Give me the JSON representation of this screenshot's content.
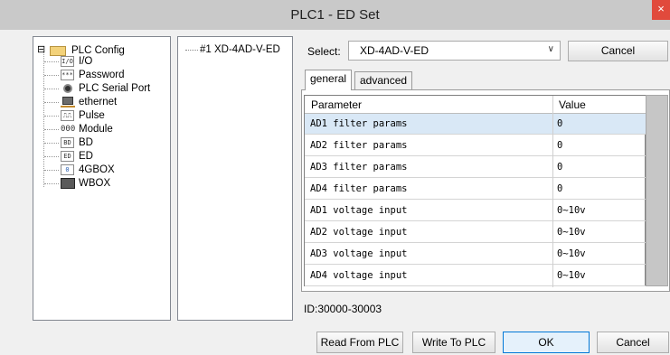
{
  "window": {
    "title": "PLC1 - ED Set",
    "close_glyph": "×"
  },
  "tree": {
    "root": {
      "label": "PLC Config",
      "icon": "folder-icon",
      "expander": "⊟"
    },
    "items": [
      {
        "label": "I/O",
        "icon_text": "I/O",
        "icon": "io-icon"
      },
      {
        "label": "Password",
        "icon_text": "***",
        "icon": "password-icon"
      },
      {
        "label": "PLC Serial Port",
        "icon_text": "",
        "icon": "serial-port-icon"
      },
      {
        "label": "ethernet",
        "icon_text": "",
        "icon": "ethernet-icon"
      },
      {
        "label": "Pulse",
        "icon_text": "⎍⎍",
        "icon": "pulse-icon"
      },
      {
        "label": "Module",
        "icon_text": "000",
        "icon": "module-icon"
      },
      {
        "label": "BD",
        "icon_text": "BD",
        "icon": "bd-icon"
      },
      {
        "label": "ED",
        "icon_text": "ED",
        "icon": "ed-icon"
      },
      {
        "label": "4GBOX",
        "icon_text": "0",
        "icon": "4gbox-icon"
      },
      {
        "label": "WBOX",
        "icon_text": "",
        "icon": "wbox-icon"
      }
    ]
  },
  "slots": {
    "items": [
      {
        "label": "#1 XD-4AD-V-ED"
      }
    ]
  },
  "select": {
    "label": "Select:",
    "value": "XD-4AD-V-ED",
    "cancel_label": "Cancel"
  },
  "tabs": [
    {
      "label": "general",
      "active": true
    },
    {
      "label": "advanced",
      "active": false
    }
  ],
  "table": {
    "headers": {
      "param": "Parameter",
      "value": "Value"
    },
    "rows": [
      {
        "param": "AD1 filter params",
        "value": "0"
      },
      {
        "param": "AD2 filter params",
        "value": "0"
      },
      {
        "param": "AD3 filter params",
        "value": "0"
      },
      {
        "param": "AD4 filter params",
        "value": "0"
      },
      {
        "param": "AD1 voltage input",
        "value": "0~10v"
      },
      {
        "param": "AD2 voltage input",
        "value": "0~10v"
      },
      {
        "param": "AD3 voltage input",
        "value": "0~10v"
      },
      {
        "param": "AD4 voltage input",
        "value": "0~10v"
      }
    ]
  },
  "id_range": "ID:30000-30003",
  "buttons": {
    "read": "Read From PLC",
    "write": "Write To PLC",
    "ok": "OK",
    "cancel": "Cancel"
  },
  "colors": {
    "titlebar": "#c9c9c9",
    "close": "#e14a3c",
    "selected_row": "#d9e8f6",
    "ok_border": "#0078d7"
  }
}
